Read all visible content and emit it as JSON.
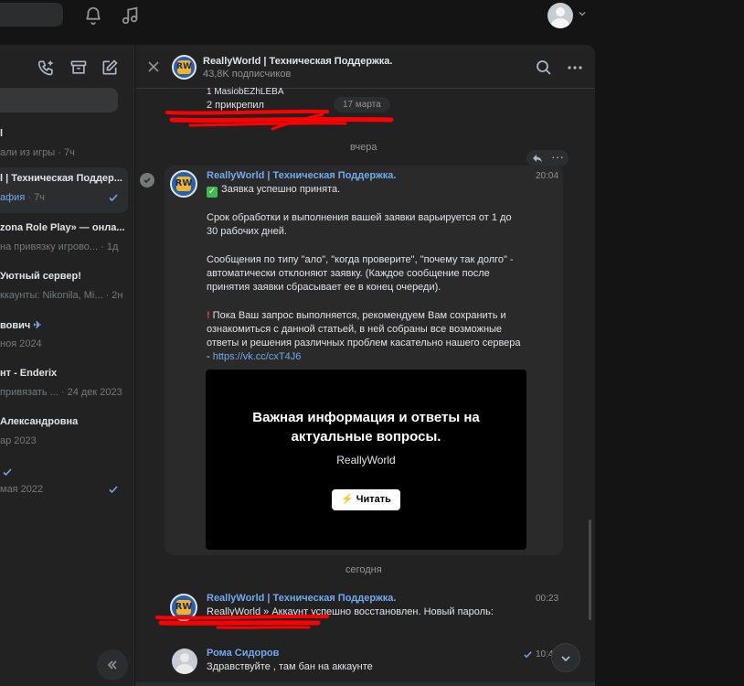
{
  "chat_list": {
    "items": [
      {
        "title": "l",
        "subtitle": "али из игры",
        "time": "· 7ч"
      },
      {
        "title": "l | Техническая Поддер...",
        "subtitle": "афия",
        "time": "· 7ч"
      },
      {
        "title": "zona Role Play» — онла...",
        "subtitle": "на привязку игрово...",
        "time": "· 1д"
      },
      {
        "title": "Уютный сервер!",
        "subtitle": "ккаунты: Nikonila, Mi...",
        "time": "· 2н"
      },
      {
        "title": "вович",
        "subtitle": "ноя 2024",
        "time": ""
      },
      {
        "title": "нт - Enderix",
        "subtitle": "привязать ...",
        "time": "· 24 дек 2023"
      },
      {
        "title": "Александровна",
        "subtitle": "ар 2023",
        "time": ""
      },
      {
        "title": "",
        "subtitle": "мая 2022",
        "time": ""
      }
    ]
  },
  "header": {
    "title": "ReallyWorld | Техническая Поддержка.",
    "subscribers": "43,8K подписчиков"
  },
  "top_message": {
    "line1": "1 MasiobEZhLEBA",
    "line2": "2 прикрепил",
    "date": "17 марта"
  },
  "separators": {
    "yesterday": "вчера",
    "today": "сегодня"
  },
  "message1": {
    "sender": "ReallyWorld | Техническая Поддержка.",
    "time": "20:04",
    "lines": [
      "Заявка успешно принята.",
      "Срок обработки и выполнения вашей заявки варьируется от 1 до",
      "30 рабочих дней.",
      "Сообщения по типу \"ало\", \"когда проверите\", \"почему так долго\" -",
      "автоматически отклоняют заявку. (Каждое сообщение после",
      "принятия заявки сбрасывает ее в конец очереди).",
      "Пока Ваш запрос выполняется, рекомендуем Вам сохранить и",
      "ознакомиться с данной статьей, в ней собраны все возможные",
      "ответы и решения различных проблем касательно нашего сервера",
      "- ",
      "https://vk.cc/cxT4J6"
    ],
    "card": {
      "title1": "Важная информация и ответы на",
      "title2": "актуальные вопросы.",
      "subtitle": "ReallyWorld",
      "button": "Читать"
    }
  },
  "message2": {
    "sender": "ReallyWorld | Техническая Поддержка.",
    "time": "00:23",
    "text": "ReallyWorld » Аккаунт успешно восстановлен. Новый пароль:"
  },
  "message3": {
    "sender": "Рома Сидоров",
    "time": "10:4",
    "text": "Здравствуйте , там бан на аккаунте"
  },
  "colors": {
    "accent": "#71aaeb",
    "background": "#222222",
    "redaction": "#ff0000"
  }
}
